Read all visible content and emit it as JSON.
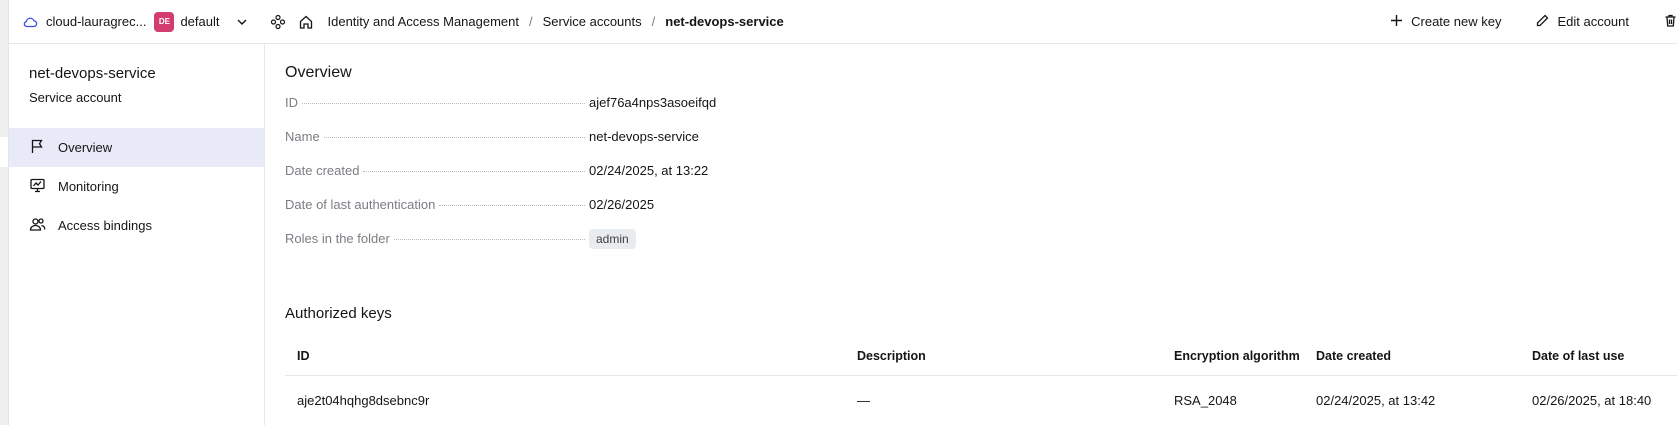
{
  "header": {
    "cloud_name": "cloud-lauragrec...",
    "folder_badge": "DE",
    "folder_name": "default",
    "breadcrumbs": [
      "Identity and Access Management",
      "Service accounts",
      "net-devops-service"
    ],
    "actions": {
      "create_key": "Create new key",
      "edit_account": "Edit account"
    }
  },
  "sidebar": {
    "title": "net-devops-service",
    "subtitle": "Service account",
    "items": [
      {
        "label": "Overview",
        "icon": "flag-icon",
        "active": true
      },
      {
        "label": "Monitoring",
        "icon": "monitor-chart-icon",
        "active": false
      },
      {
        "label": "Access bindings",
        "icon": "users-icon",
        "active": false
      }
    ]
  },
  "overview": {
    "heading": "Overview",
    "props": [
      {
        "key": "ID",
        "value": "ajef76a4nps3asoeifqd"
      },
      {
        "key": "Name",
        "value": "net-devops-service"
      },
      {
        "key": "Date created",
        "value": "02/24/2025, at 13:22"
      },
      {
        "key": "Date of last authentication",
        "value": "02/26/2025"
      },
      {
        "key": "Roles in the folder",
        "value": "admin"
      }
    ]
  },
  "keys": {
    "heading": "Authorized keys",
    "columns": [
      "ID",
      "Description",
      "Encryption algorithm",
      "Date created",
      "Date of last use"
    ],
    "rows": [
      [
        "aje2t04hqhg8dsebnc9r",
        "—",
        "RSA_2048",
        "02/24/2025, at 13:42",
        "02/26/2025, at 18:40"
      ]
    ]
  },
  "colors": {
    "accent": "#3a50e0",
    "folder_badge": "#d23c6f",
    "active_nav": "#e8eaf8"
  }
}
